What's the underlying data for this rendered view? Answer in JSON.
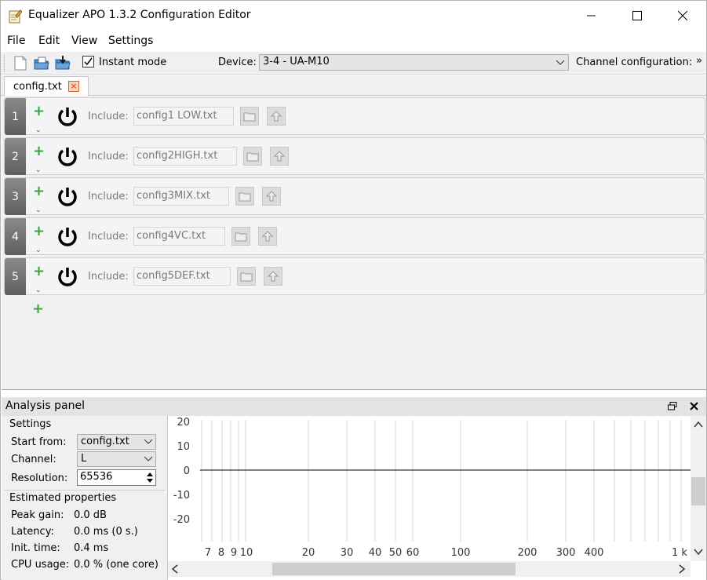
{
  "window": {
    "title": "Equalizer APO 1.3.2 Configuration Editor"
  },
  "menu": [
    "File",
    "Edit",
    "View",
    "Settings"
  ],
  "toolbar": {
    "instant_mode_label": "Instant mode",
    "instant_mode_checked": true,
    "device_label": "Device:",
    "device_value": "3-4 - UA-M10",
    "channel_config_label": "Channel configuration:",
    "overflow": "»"
  },
  "tabs": [
    {
      "label": "config.txt",
      "close": "×"
    }
  ],
  "rows": [
    {
      "num": "1",
      "include_label": "Include:",
      "file": "config1 LOW.txt"
    },
    {
      "num": "2",
      "include_label": "Include:",
      "file": "config2HIGH.txt"
    },
    {
      "num": "3",
      "include_label": "Include:",
      "file": "config3MIX.txt"
    },
    {
      "num": "4",
      "include_label": "Include:",
      "file": "config4VC.txt"
    },
    {
      "num": "5",
      "include_label": "Include:",
      "file": "config5DEF.txt"
    }
  ],
  "analysis": {
    "title": "Analysis panel",
    "settings_title": "Settings",
    "start_from_label": "Start from:",
    "start_from_value": "config.txt",
    "channel_label": "Channel:",
    "channel_value": "L",
    "resolution_label": "Resolution:",
    "resolution_value": "65536",
    "estimated_title": "Estimated properties",
    "peak_gain_label": "Peak gain:",
    "peak_gain_value": "0.0 dB",
    "latency_label": "Latency:",
    "latency_value": "0.0 ms (0 s.)",
    "init_time_label": "Init. time:",
    "init_time_value": "0.4 ms",
    "cpu_usage_label": "CPU usage:",
    "cpu_usage_value": "0.0 % (one core)"
  },
  "graph": {
    "y_ticks": [
      "20",
      "10",
      "0",
      "-10",
      "-20"
    ],
    "x_ticks": [
      "7",
      "8",
      "9",
      "10",
      "20",
      "30",
      "40",
      "50",
      "60",
      "100",
      "200",
      "300",
      "400",
      "1 k"
    ]
  },
  "colors": {
    "plus_green": "#3fa33f",
    "tab_close_orange": "#d9622b",
    "row_number_bg": "#6e6e6e"
  }
}
